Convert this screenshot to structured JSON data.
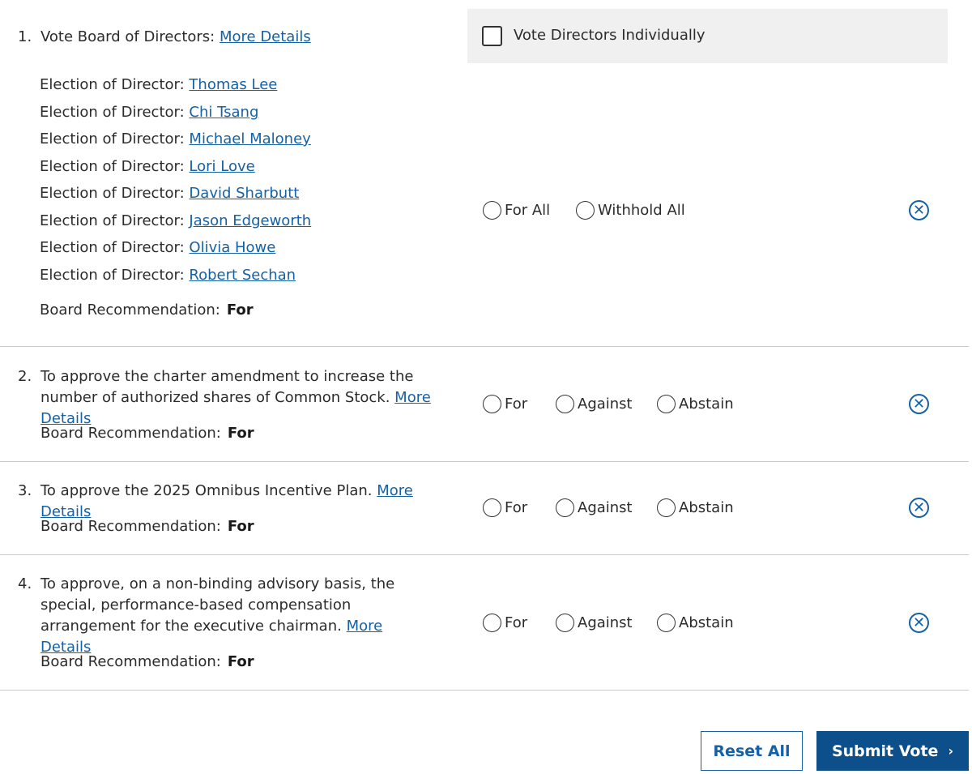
{
  "proposal1": {
    "number": "1.",
    "title": "Vote Board of Directors:",
    "more_details": "More Details",
    "vote_individually_label": "Vote Directors Individually",
    "election_prefix": "Election of Director:",
    "directors": [
      "Thomas Lee",
      "Chi Tsang",
      "Michael Maloney",
      "Lori Love",
      "David Sharbutt",
      "Jason Edgeworth",
      "Olivia Howe",
      "Robert Sechan"
    ],
    "rec_label": "Board Recommendation:",
    "rec_value": "For",
    "options": [
      "For All",
      "Withhold All"
    ]
  },
  "proposal2": {
    "number": "2.",
    "text": "To approve the charter amendment to increase the number of authorized shares of Common Stock.",
    "more_details": "More Details",
    "rec_label": "Board Recommendation:",
    "rec_value": "For",
    "options": [
      "For",
      "Against",
      "Abstain"
    ]
  },
  "proposal3": {
    "number": "3.",
    "text": "To approve the 2025 Omnibus Incentive Plan.",
    "more_details": "More Details",
    "rec_label": "Board Recommendation:",
    "rec_value": "For",
    "options": [
      "For",
      "Against",
      "Abstain"
    ]
  },
  "proposal4": {
    "number": "4.",
    "text": "To approve, on a non-binding advisory basis, the special, performance-based compensation arrangement for the executive chairman.",
    "more_details": "More Details",
    "rec_label": "Board Recommendation:",
    "rec_value": "For",
    "options": [
      "For",
      "Against",
      "Abstain"
    ]
  },
  "clear_icon": "close-circle-icon",
  "footer": {
    "reset_label": "Reset All",
    "submit_label": "Submit Vote",
    "submit_icon": "chevron-right-icon"
  }
}
